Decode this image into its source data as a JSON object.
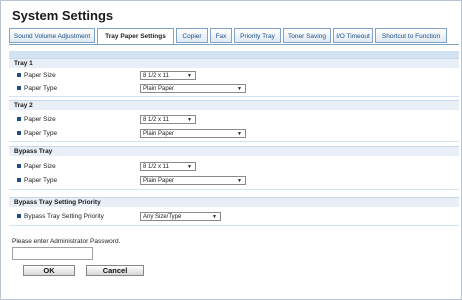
{
  "page_title": "System Settings",
  "tabs": [
    {
      "label": "Sound Volume Adjustment",
      "active": false
    },
    {
      "label": "Tray Paper Settings",
      "active": true
    },
    {
      "label": "Copier",
      "active": false
    },
    {
      "label": "Fax",
      "active": false
    },
    {
      "label": "Priority Tray",
      "active": false
    },
    {
      "label": "Toner Saving",
      "active": false
    },
    {
      "label": "I/O Timeout",
      "active": false
    },
    {
      "label": "Shortcut to Function",
      "active": false
    }
  ],
  "sections": {
    "tray1": {
      "title": "Tray 1",
      "paper_size_label": "Paper Size",
      "paper_size_value": "8 1/2 x 11",
      "paper_type_label": "Paper Type",
      "paper_type_value": "Plain Paper"
    },
    "tray2": {
      "title": "Tray 2",
      "paper_size_label": "Paper Size",
      "paper_size_value": "8 1/2 x 11",
      "paper_type_label": "Paper Type",
      "paper_type_value": "Plain Paper"
    },
    "bypass": {
      "title": "Bypass Tray",
      "paper_size_label": "Paper Size",
      "paper_size_value": "8 1/2 x 11",
      "paper_type_label": "Paper Type",
      "paper_type_value": "Plain Paper"
    },
    "priority": {
      "title": "Bypass Tray Setting Priority",
      "setting_label": "Bypass Tray Setting Priority",
      "setting_value": "Any Size/Type"
    }
  },
  "password": {
    "label": "Please enter Administrator Password.",
    "value": ""
  },
  "buttons": {
    "ok_label": "OK",
    "cancel_label": "Cancel"
  },
  "colors": {
    "accent": "#1d4f86",
    "section_band": "#d4e3f1"
  }
}
